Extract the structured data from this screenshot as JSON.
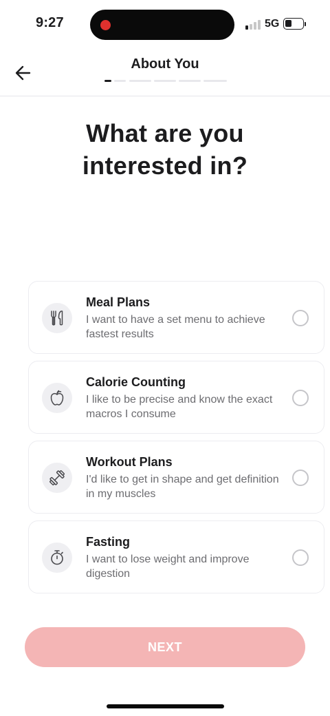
{
  "status_bar": {
    "time": "9:27",
    "network": "5G",
    "signal_bars_active": 1,
    "signal_bars_total": 4,
    "battery_level_pct": 35,
    "recording_indicator_color": "#e0312e"
  },
  "header": {
    "back_icon": "arrow-left-icon",
    "title": "About You",
    "progress_steps_total": 5,
    "progress_step_current": 1
  },
  "main": {
    "question": "What are you interested in?"
  },
  "options": [
    {
      "icon": "fork-knife-icon",
      "title": "Meal Plans",
      "description": "I want to have a set menu to achieve fastest results",
      "selected": false
    },
    {
      "icon": "apple-icon",
      "title": "Calorie Counting",
      "description": "I like to be precise and know the exact macros I consume",
      "selected": false
    },
    {
      "icon": "dumbbell-icon",
      "title": "Workout Plans",
      "description": "I'd like to get in shape and get definition in my muscles",
      "selected": false
    },
    {
      "icon": "stopwatch-icon",
      "title": "Fasting",
      "description": "I want to lose weight and improve digestion",
      "selected": false
    }
  ],
  "footer": {
    "next_label": "NEXT",
    "next_color": "#f4b5b5"
  },
  "colors": {
    "text_primary": "#1c1c1e",
    "text_secondary": "#6c6c70",
    "card_border": "#ececf0",
    "icon_bg": "#efeff2"
  }
}
